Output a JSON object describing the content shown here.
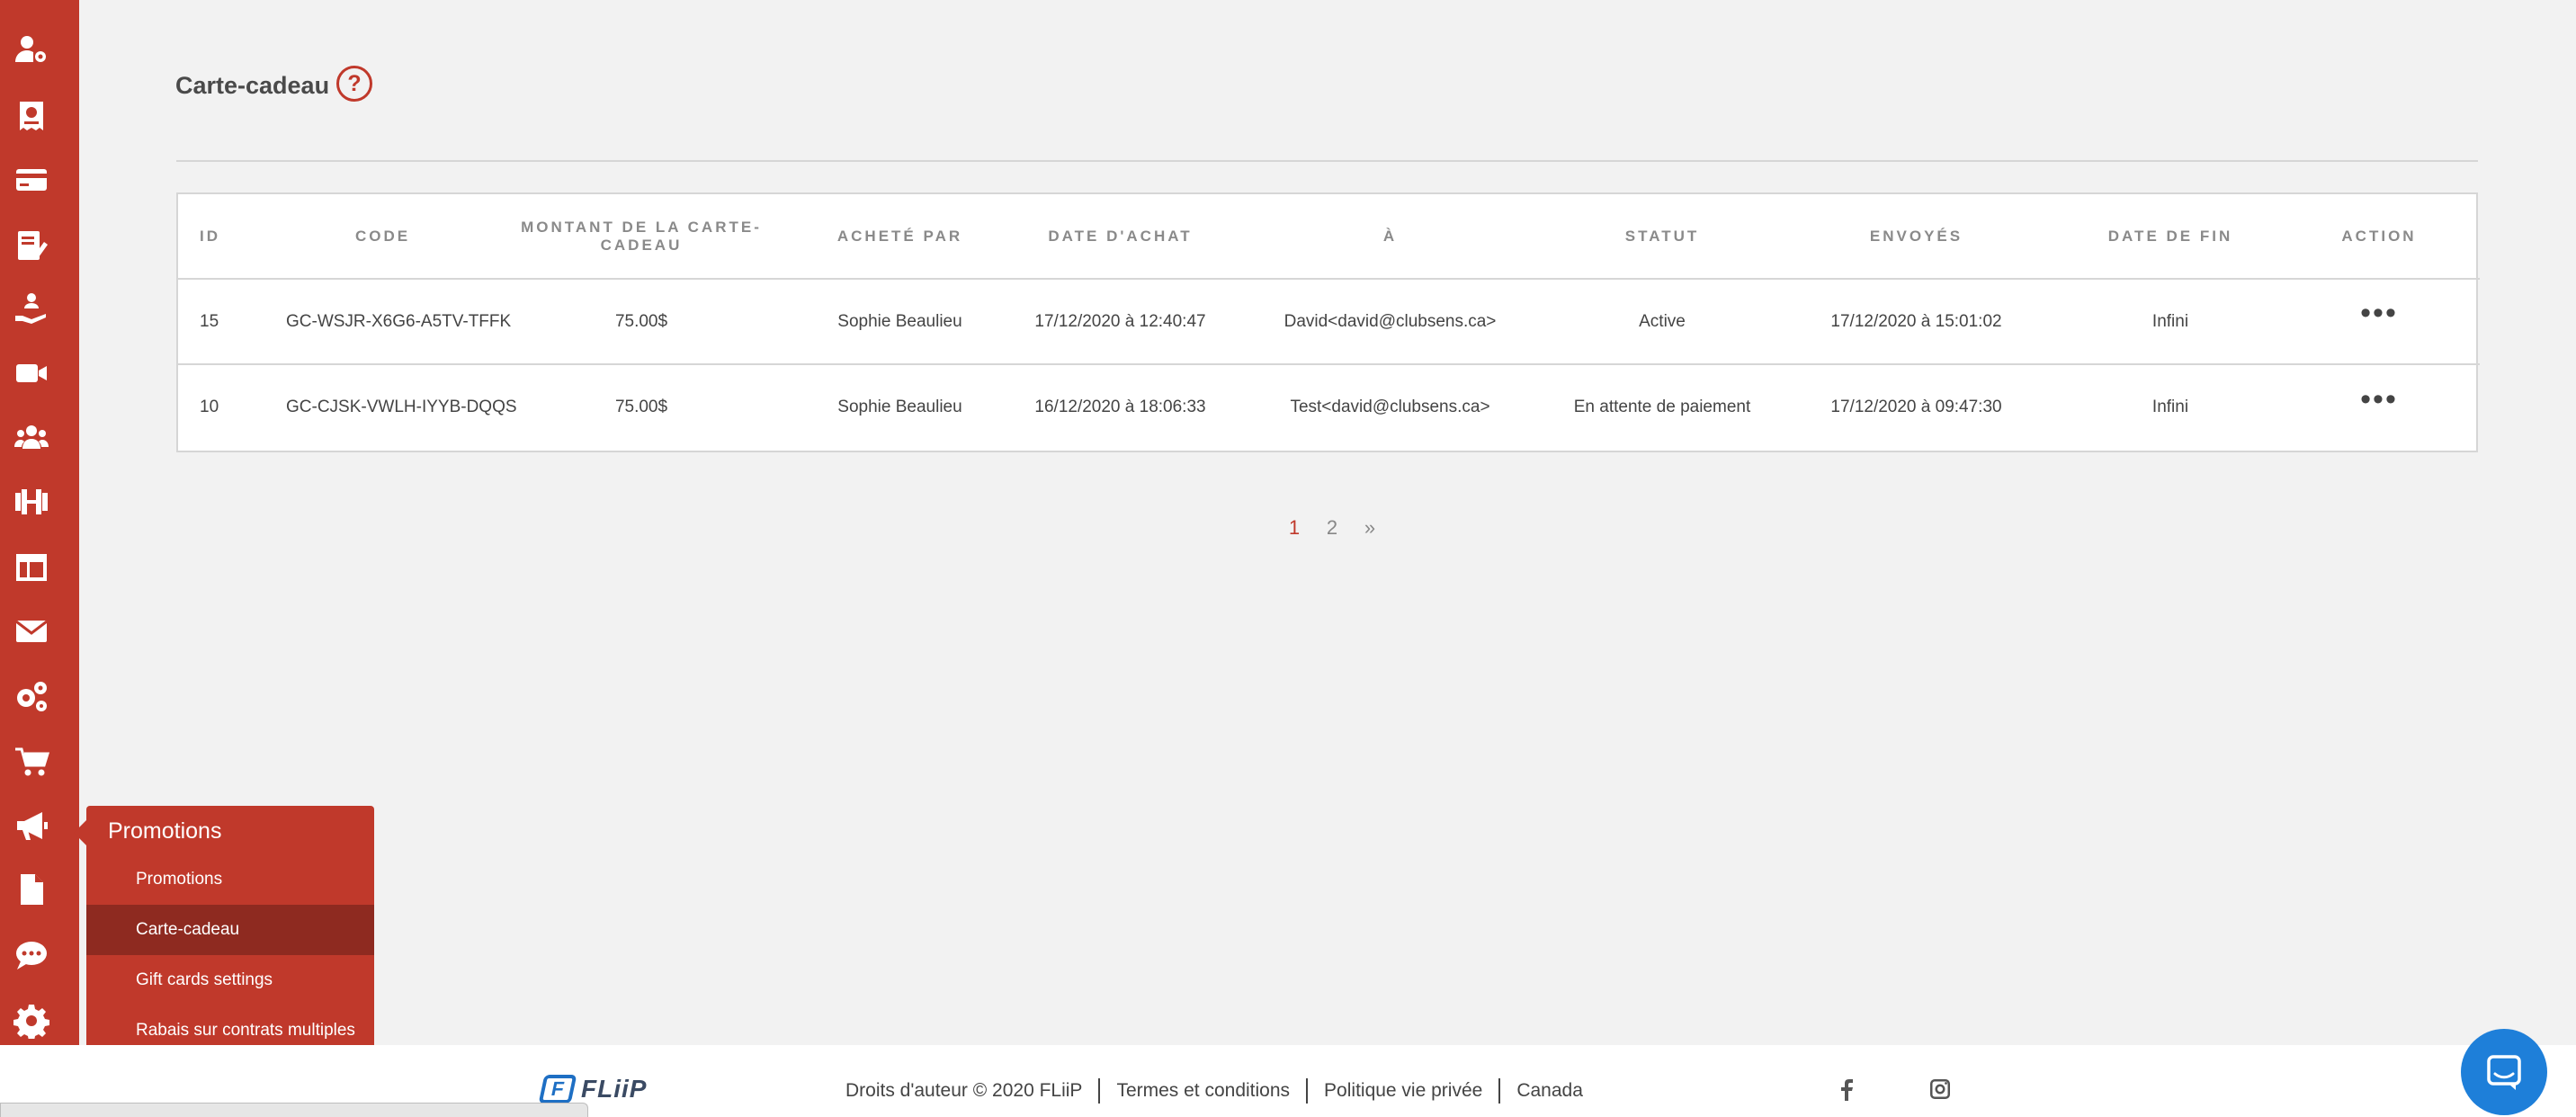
{
  "sidebar": {
    "icons": [
      {
        "name": "user-settings-icon"
      },
      {
        "name": "invoice-icon"
      },
      {
        "name": "credit-card-icon"
      },
      {
        "name": "edit-document-icon"
      },
      {
        "name": "hand-service-icon"
      },
      {
        "name": "video-camera-icon"
      },
      {
        "name": "users-group-icon"
      },
      {
        "name": "dumbbell-icon"
      },
      {
        "name": "layout-icon"
      },
      {
        "name": "envelope-icon"
      },
      {
        "name": "gears-icon"
      },
      {
        "name": "shopping-cart-icon"
      },
      {
        "name": "megaphone-icon"
      },
      {
        "name": "file-icon"
      },
      {
        "name": "chat-bubble-icon"
      },
      {
        "name": "settings-gear-icon"
      }
    ],
    "accent_color": "#c0392b"
  },
  "flyout": {
    "title": "Promotions",
    "items": [
      {
        "label": "Promotions",
        "active": false
      },
      {
        "label": "Carte-cadeau",
        "active": true
      },
      {
        "label": "Gift cards settings",
        "active": false
      },
      {
        "label": "Rabais sur contrats multiples",
        "active": false
      }
    ]
  },
  "page": {
    "title": "Carte-cadeau",
    "help_symbol": "?"
  },
  "table": {
    "columns": [
      "ID",
      "CODE",
      "MONTANT DE LA CARTE-CADEAU",
      "ACHETÉ PAR",
      "DATE D'ACHAT",
      "À",
      "STATUT",
      "ENVOYÉS",
      "DATE DE FIN",
      "ACTION"
    ],
    "rows": [
      {
        "id": "15",
        "code": "GC-WSJR-X6G6-A5TV-TFFK",
        "amount": "75.00$",
        "buyer": "Sophie Beaulieu",
        "purchase_date": "17/12/2020 à 12:40:47",
        "to": "David<david@clubsens.ca>",
        "status": "Active",
        "sent": "17/12/2020 à 15:01:02",
        "end_date": "Infini",
        "action": "•••"
      },
      {
        "id": "10",
        "code": "GC-CJSK-VWLH-IYYB-DQQS",
        "amount": "75.00$",
        "buyer": "Sophie Beaulieu",
        "purchase_date": "16/12/2020 à 18:06:33",
        "to": "Test<david@clubsens.ca>",
        "status": "En attente de paiement",
        "sent": "17/12/2020 à 09:47:30",
        "end_date": "Infini",
        "action": "•••"
      }
    ]
  },
  "pagination": {
    "current": "1",
    "next_page": "2",
    "next_symbol": "»"
  },
  "footer": {
    "logo_mark": "F",
    "logo_text": "FLiiP",
    "links": [
      "Droits d'auteur © 2020 FLiiP",
      "Termes et conditions",
      "Politique vie privée",
      "Canada"
    ],
    "social": [
      "facebook-icon",
      "instagram-icon"
    ]
  },
  "chat": {
    "icon": "chat-launcher-icon",
    "color": "#1e7fd9"
  }
}
